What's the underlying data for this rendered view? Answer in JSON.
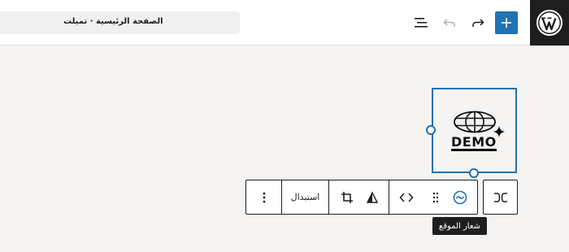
{
  "header": {
    "document_title": "الصفحة الرئيسية · تميلت",
    "buttons": {
      "inserter": "plus-icon",
      "redo": "redo-icon",
      "undo": "undo-icon",
      "document_overview": "list-view-icon"
    }
  },
  "logo_block": {
    "text": "DEMO"
  },
  "toolbar": {
    "replace_label": "استبدال",
    "block_icon": "site-logo-icon"
  },
  "tooltip": {
    "text": "شعار الموقع"
  },
  "colors": {
    "accent": "#2271b1",
    "dark": "#1e1e1e",
    "canvas": "#f5f4f2"
  }
}
